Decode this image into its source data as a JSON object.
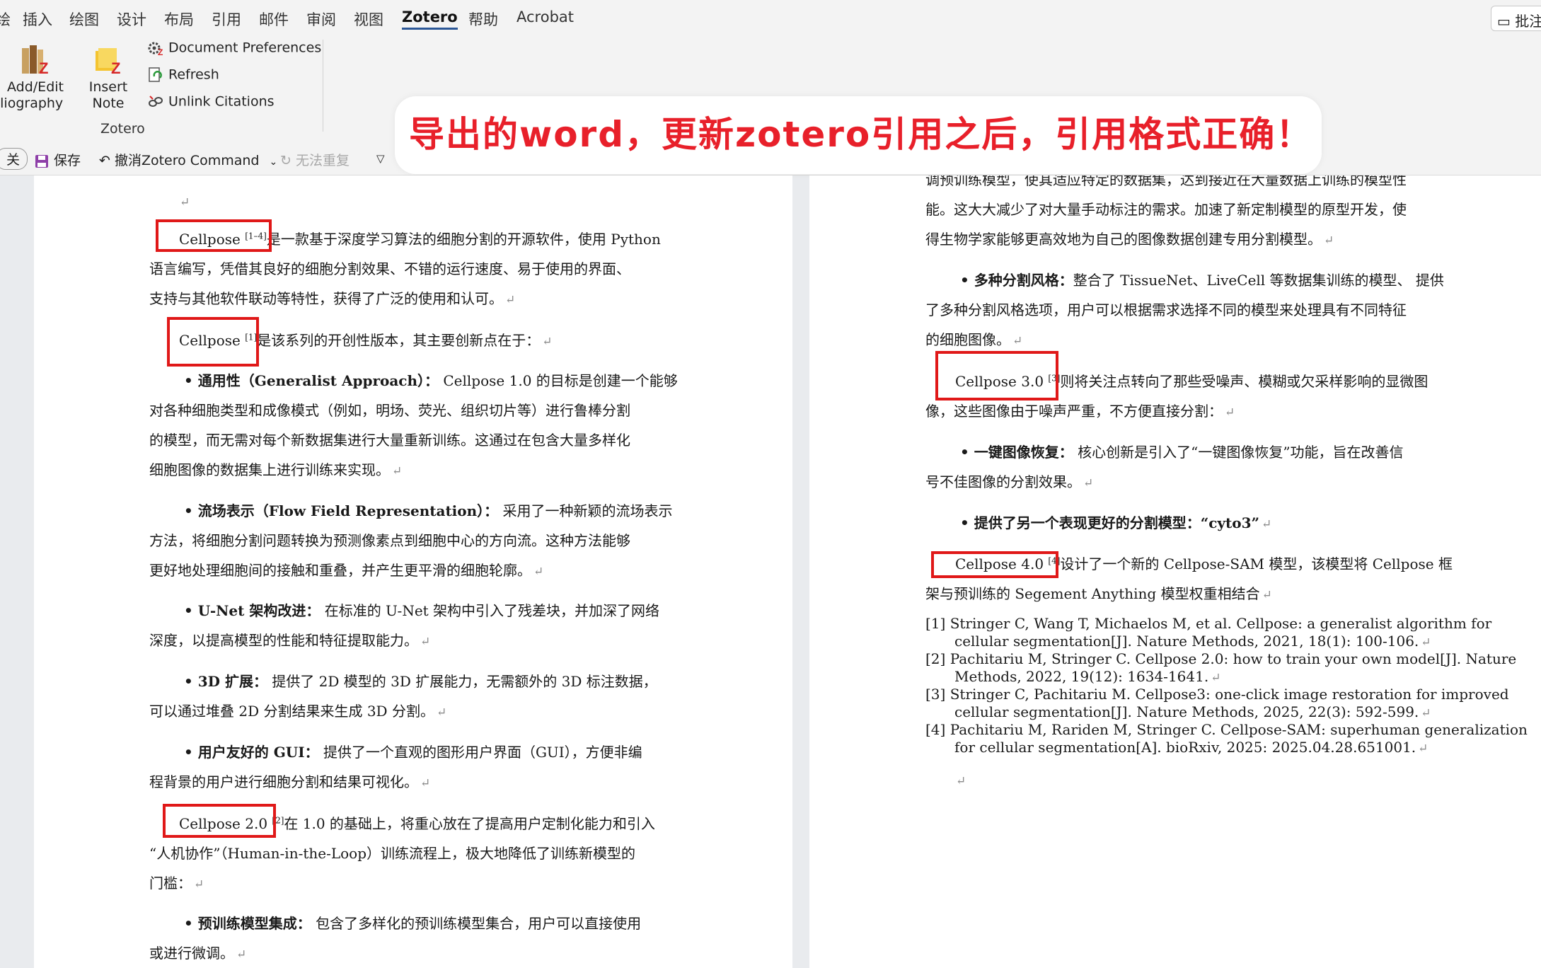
{
  "ribbon_tabs": [
    "绘",
    "插入",
    "绘图",
    "设计",
    "布局",
    "引用",
    "邮件",
    "审阅",
    "视图",
    "Zotero",
    "帮助",
    "Acrobat"
  ],
  "comment_button": "批注",
  "zotero_group": {
    "add_edit_bibliography": [
      "Add/Edit",
      "ibliography"
    ],
    "insert_note": [
      "Insert",
      "Note"
    ],
    "document_preferences": "Document Preferences",
    "refresh": "Refresh",
    "unlink_citations": "Unlink Citations",
    "group_label": "Zotero"
  },
  "quick_access": {
    "close": "关",
    "save": "保存",
    "undo": "撤消Zotero Command",
    "redo": "无法重复"
  },
  "banner": "导出的word，更新zotero引用之后，引用格式正确！",
  "left_page": {
    "p1": [
      "Cellpose",
      "[1–4]",
      "是一款基于深度学习算法的细胞分割的开源软件，使用 Python"
    ],
    "p1_l2": "语言编写，凭借其良好的细胞分割效果、不错的运行速度、易于使用的界面、",
    "p1_l3": "支持与其他软件联动等特性，获得了广泛的使用和认可。",
    "p2": [
      "Cellpose",
      "[1]",
      "是该系列的开创性版本，其主要创新点在于："
    ],
    "b1": [
      "• 通用性（Generalist Approach）：",
      " Cellpose 1.0 的目标是创建一个能够"
    ],
    "b1_l2": "对各种细胞类型和成像模式（例如，明场、荧光、组织切片等）进行鲁棒分割",
    "b1_l3": "的模型，而无需对每个新数据集进行大量重新训练。这通过在包含大量多样化",
    "b1_l4": "细胞图像的数据集上进行训练来实现。",
    "b2": [
      "• 流场表示（Flow Field Representation）：",
      " 采用了一种新颖的流场表示"
    ],
    "b2_l2": "方法，将细胞分割问题转换为预测像素点到细胞中心的方向流。这种方法能够",
    "b2_l3": "更好地处理细胞间的接触和重叠，并产生更平滑的细胞轮廓。",
    "b3": [
      "• U-Net 架构改进：",
      " 在标准的 U-Net 架构中引入了残差块，并加深了网络"
    ],
    "b3_l2": "深度，以提高模型的性能和特征提取能力。",
    "b4": [
      "• 3D 扩展：",
      " 提供了 2D 模型的 3D 扩展能力，无需额外的 3D 标注数据，"
    ],
    "b4_l2": "可以通过堆叠 2D 分割结果来生成 3D 分割。",
    "b5": [
      "• 用户友好的 GUI：",
      " 提供了一个直观的图形用户界面（GUI），方便非编"
    ],
    "b5_l2": "程背景的用户进行细胞分割和结果可视化。",
    "p3": [
      "Cellpose 2.0",
      "[2]",
      "在 1.0 的基础上，将重心放在了提高用户定制化能力和引入"
    ],
    "p3_l2": "“人机协作”（Human-in-the-Loop）训练流程上，极大地降低了训练新模型的",
    "p3_l3": "门槛：",
    "b6": [
      "• 预训练模型集成：",
      " 包含了多样化的预训练模型集合，用户可以直接使用"
    ],
    "b6_l2": "或进行微调。"
  },
  "right_page": {
    "l0": "调预训练模型，使其适应特定的数据集，达到接近在大量数据上训练的模型性",
    "l1": "能。这大大减少了对大量手动标注的需求。加速了新定制模型的原型开发，使",
    "l2": "得生物学家能够更高效地为自己的图像数据创建专用分割模型。",
    "b7": [
      "• 多种分割风格：",
      "整合了 TissueNet、LiveCell 等数据集训练的模型、 提供"
    ],
    "b7_l2": "了多种分割风格选项，用户可以根据需求选择不同的模型来处理具有不同特征",
    "b7_l3": "的细胞图像。",
    "p4": [
      "Cellpose 3.0",
      "[3]",
      "则将关注点转向了那些受噪声、模糊或欠采样影响的显微图"
    ],
    "p4_l2": "像，这些图像由于噪声严重，不方便直接分割：",
    "b8": [
      "• 一键图像恢复：",
      " 核心创新是引入了“一键图像恢复”功能，旨在改善信"
    ],
    "b8_l2": "号不佳图像的分割效果。",
    "b9": "• 提供了另一个表现更好的分割模型：“cyto3”",
    "p5": [
      "Cellpose 4.0",
      "[4]",
      "设计了一个新的 Cellpose-SAM 模型，该模型将 Cellpose 框"
    ],
    "p5_l2": "架与预训练的 Segement Anything 模型权重相结合",
    "refs": [
      [
        "[1]  Stringer C, Wang T, Michaelos M, et al. Cellpose: a generalist algorithm for",
        "cellular segmentation[J]. Nature Methods, 2021, 18(1): 100-106."
      ],
      [
        "[2]  Pachitariu M, Stringer C. Cellpose 2.0: how to train your own model[J]. Nature",
        "Methods, 2022, 19(12): 1634-1641."
      ],
      [
        "[3]  Stringer C, Pachitariu M. Cellpose3: one-click image restoration for improved",
        "cellular segmentation[J]. Nature Methods, 2025, 22(3): 592-599."
      ],
      [
        "[4]  Pachitariu M, Rariden M, Stringer C. Cellpose-SAM: superhuman generalization",
        "for cellular segmentation[A]. bioRxiv, 2025: 2025.04.28.651001."
      ]
    ]
  }
}
